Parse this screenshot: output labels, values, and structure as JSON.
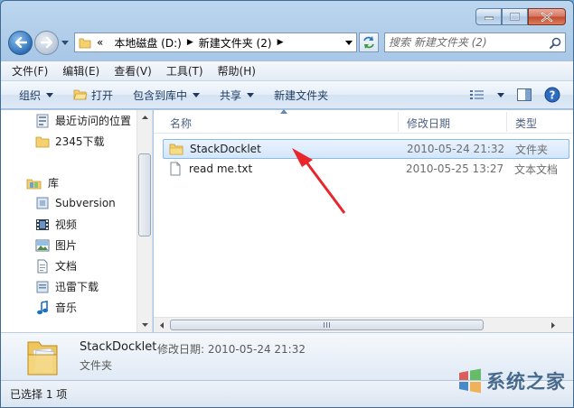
{
  "nav": {
    "address_segments": [
      "本地磁盘 (D:)",
      "新建文件夹 (2)"
    ],
    "search_placeholder": "搜索 新建文件夹 (2)"
  },
  "menu": [
    "文件(F)",
    "编辑(E)",
    "查看(V)",
    "工具(T)",
    "帮助(H)"
  ],
  "toolbar": {
    "organize": "组织",
    "open": "打开",
    "include_library": "包含到库中",
    "share": "共享",
    "new_folder": "新建文件夹"
  },
  "sidebar": {
    "recent": "最近访问的位置",
    "downloads_2345": "2345下载",
    "library_header": "库",
    "libraries": [
      "Subversion",
      "视频",
      "图片",
      "文档",
      "迅雷下载",
      "音乐"
    ]
  },
  "columns": {
    "name": "名称",
    "modified": "修改日期",
    "type": "类型"
  },
  "files": [
    {
      "name": "StackDocklet",
      "modified": "2010-05-24 21:32",
      "type": "文件夹",
      "icon": "folder-icon",
      "selected": true
    },
    {
      "name": "read me.txt",
      "modified": "2010-05-25 13:27",
      "type": "文本文档",
      "icon": "text-file-icon",
      "selected": false
    }
  ],
  "details": {
    "name": "StackDocklet",
    "meta": "修改日期: 2010-05-24 21:32",
    "type": "文件夹"
  },
  "status": {
    "text": "已选择 1 项"
  },
  "watermark": {
    "text": "系统之家"
  },
  "colors": {
    "selection": "#d3e6fb",
    "annotation_arrow": "#e8262b",
    "chrome": "#a9c8e7"
  }
}
